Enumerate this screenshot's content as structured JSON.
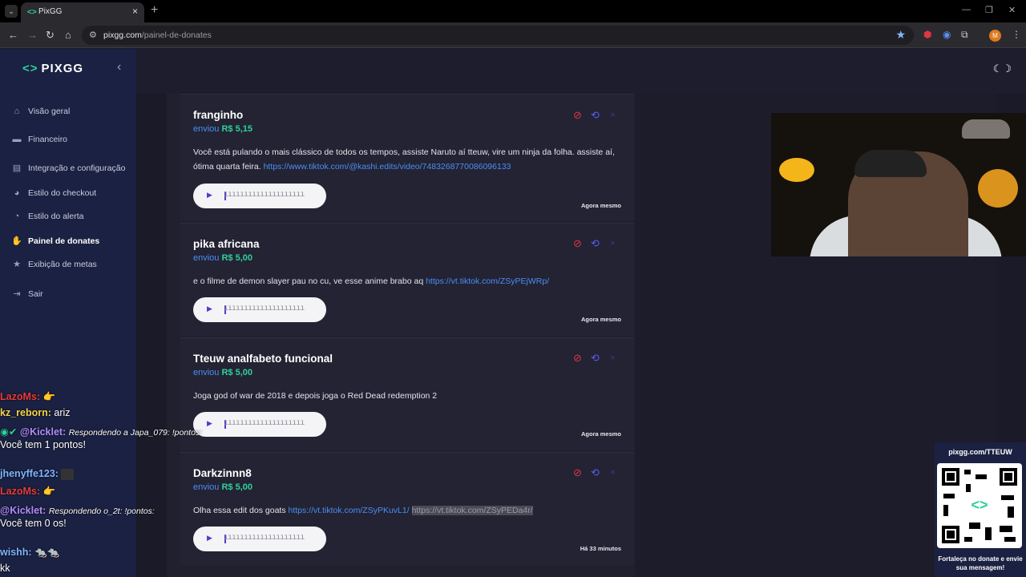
{
  "browser": {
    "tab_title": "PixGG",
    "url_host": "pixgg.com",
    "url_path": "/painel-de-donates",
    "profile_initial": "M"
  },
  "sidebar": {
    "logo": "PIXGG",
    "items": [
      {
        "label": "Visão geral",
        "icon": "home-icon"
      },
      {
        "label": "Financeiro",
        "icon": "wallet-icon"
      },
      {
        "label": "Integração e configuração",
        "icon": "settings-icon"
      },
      {
        "label": "Estilo do checkout",
        "icon": "palette-icon"
      },
      {
        "label": "Estilo do alerta",
        "icon": "brush-icon"
      },
      {
        "label": "Painel de donates",
        "icon": "donate-icon"
      },
      {
        "label": "Exibição de metas",
        "icon": "star-icon"
      },
      {
        "label": "Sair",
        "icon": "logout-icon"
      }
    ]
  },
  "donates": [
    {
      "name": "franginho",
      "sent_label": "enviou",
      "amount": "R$ 5,15",
      "message": "Você está pulando o mais clássico de todos os tempos, assiste Naruto aí tteuw, vire um ninja da folha. assiste aí, ótima quarta feira.",
      "link": "https://www.tiktok.com/@kashi.edits/video/7483268770086096133",
      "time": "Agora mesmo"
    },
    {
      "name": "pika africana",
      "sent_label": "enviou",
      "amount": "R$ 5,00",
      "message": "e o filme de demon slayer pau no cu, ve esse anime brabo aq",
      "link": "https://vt.tiktok.com/ZSyPEjWRp/",
      "time": "Agora mesmo"
    },
    {
      "name": "Tteuw analfabeto funcional",
      "sent_label": "enviou",
      "amount": "R$ 5,00",
      "message": "Joga god of war de 2018 e depois joga o Red Dead redemption 2",
      "link": "",
      "time": "Agora mesmo"
    },
    {
      "name": "Darkzinnn8",
      "sent_label": "enviou",
      "amount": "R$ 5,00",
      "message": "Olha essa edit dos goats",
      "link": "https://vt.tiktok.com/ZSyPKuvL1/",
      "link2": "https://vt.tiktok.com/ZSyPEDa4r/",
      "time": "Há 33 minutos"
    }
  ],
  "chat": [
    {
      "user": "LazoMs:",
      "text": "👉"
    },
    {
      "user": "kz_reborn:",
      "text": "ariz"
    },
    {
      "user": "@Kicklet:",
      "reply": "Respondendo a Japa_079: !pontos:",
      "text": "Você tem 1 pontos!"
    },
    {
      "user": "jhenyffe123:",
      "text": ""
    },
    {
      "user": "LazoMs:",
      "text": "👉"
    },
    {
      "user": "@Kicklet:",
      "reply": "Respondendo o_2t: !pontos:",
      "text": "Você tem 0 os!"
    },
    {
      "user": "wishh:",
      "text": ""
    },
    {
      "user": "",
      "text": "kk"
    }
  ],
  "qr_panel": {
    "url": "pixgg.com/TTEUW",
    "caption": "Fortaleça no donate e envie sua mensagem!"
  },
  "colors": {
    "accent_green": "#2fd19a",
    "link_blue": "#4b8ef5",
    "sidebar_bg": "#1b2142",
    "ban_red": "#e03545"
  }
}
